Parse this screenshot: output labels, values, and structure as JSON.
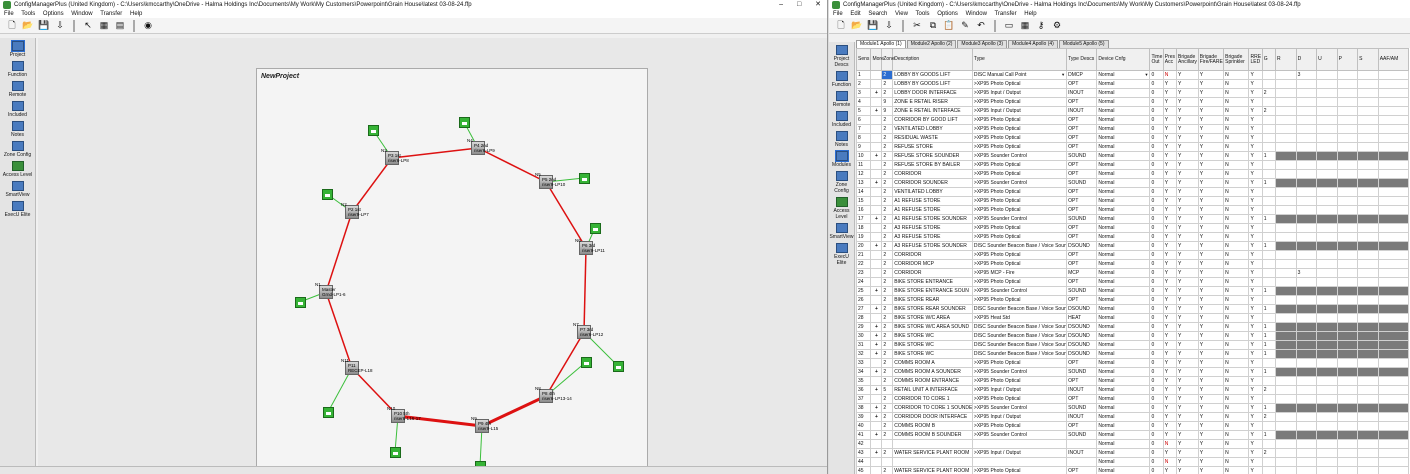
{
  "windows": [
    {
      "title": "ConfigManagerPlus (United Kingdom) - C:\\Users\\kmccarthy\\OneDrive - Halma Holdings Inc\\Documents\\My Work\\My Customers\\Powerpoint\\Grain House\\latest 03-08-24.ffp",
      "menu": [
        "File",
        "Tools",
        "Options",
        "Window",
        "Transfer",
        "Help"
      ]
    },
    {
      "title": "ConfigManagerPlus (United Kingdom) - C:\\Users\\kmccarthy\\OneDrive - Halma Holdings Inc\\Documents\\My Work\\My Customers\\Powerpoint\\Grain House\\latest 03-08-24.ffp",
      "menu": [
        "File",
        "Edit",
        "Search",
        "View",
        "Tools",
        "Options",
        "Window",
        "Transfer",
        "Help"
      ]
    }
  ],
  "window_controls": {
    "minimize": "–",
    "maximize": "□",
    "close": "✕"
  },
  "sidebar_left": [
    "Project",
    "Function",
    "Remote",
    "Included",
    "Notes",
    "Zone Config",
    "Access Level",
    "SmartView",
    "ExecU Elite"
  ],
  "sidebar_right": [
    "Project Descs",
    "Function",
    "Remote",
    "Included",
    "Notes",
    "Modules",
    "Zone Config",
    "Access Level",
    "SmartView",
    "ExecU Elite"
  ],
  "canvas": {
    "title": "NewProject"
  },
  "nodes": [
    {
      "num": "N3",
      "l1": "P3 1st",
      "l2": "riser6-LP8"
    },
    {
      "num": "N4",
      "l1": "P4 2nd",
      "l2": "riser6-LP9"
    },
    {
      "num": "N5",
      "l1": "P5 2nd",
      "l2": "riser9-LP10"
    },
    {
      "num": "N6",
      "l1": "P6 3rd",
      "l2": "riser9-LP11"
    },
    {
      "num": "N7",
      "l1": "P7 3rd",
      "l2": "riser6-LP12"
    },
    {
      "num": "N8",
      "l1": "P8 4th",
      "l2": "riser6-LP13-14"
    },
    {
      "num": "N9",
      "l1": "P9 4th",
      "l2": "riser9-L15"
    },
    {
      "num": "N10",
      "l1": "P10 5th",
      "l2": "riser6-L16-17"
    },
    {
      "num": "N11",
      "l1": "P11",
      "l2": "RECEP-L18"
    },
    {
      "num": "N1",
      "l1": "Master",
      "l2": "Grnd-LP1-6"
    },
    {
      "num": "N2",
      "l1": "P2 1st",
      "l2": "riser9-LP7"
    }
  ],
  "module_tabs": [
    "Module1 Apollo (1)",
    "Module2 Apollo (2)",
    "Module3 Apollo (3)",
    "Module4 Apollo (4)",
    "Module5 Apollo (5)"
  ],
  "columns": [
    "Sens",
    "More",
    "Zone",
    "Description",
    "Type",
    "Type Descs",
    "Device Cnfg",
    "Time Out",
    "Pres Acc",
    "Brigade Ancillary",
    "Brigade Fire/FARE",
    "Brigade Sprinkler",
    "RRE LED",
    "G",
    "R",
    "D",
    "U",
    "P",
    "S",
    "AAF/AM"
  ],
  "rows": [
    [
      "1",
      "",
      "2",
      "LOBBY BY GOODS LIFT",
      "DISC Manual Call Point",
      "DMCP",
      "Normal",
      "0",
      "N",
      "Y",
      "Y",
      "N",
      "Y",
      "",
      "3"
    ],
    [
      "2",
      "",
      "2",
      "LOBBY BY GOODS LIFT",
      ">XP95 Photo Optical",
      "OPT",
      "Normal",
      "0",
      "Y",
      "Y",
      "Y",
      "N",
      "Y",
      "",
      ""
    ],
    [
      "3",
      "+",
      "2",
      "LOBBY DOOR INTERFACE",
      ">XP95 Input / Output",
      "INOUT",
      "Normal",
      "0",
      "Y",
      "Y",
      "Y",
      "N",
      "Y",
      "2",
      ""
    ],
    [
      "4",
      "",
      "9",
      "ZONE E RETAIL RISER",
      ">XP95 Photo Optical",
      "OPT",
      "Normal",
      "0",
      "Y",
      "Y",
      "Y",
      "N",
      "Y",
      "",
      ""
    ],
    [
      "5",
      "+",
      "9",
      "ZONE E RETAIL INTERFACE",
      ">XP95 Input / Output",
      "INOUT",
      "Normal",
      "0",
      "Y",
      "Y",
      "Y",
      "N",
      "Y",
      "2",
      ""
    ],
    [
      "6",
      "",
      "2",
      "CORRIDOR BY GOOD LIFT",
      ">XP95 Photo Optical",
      "OPT",
      "Normal",
      "0",
      "Y",
      "Y",
      "Y",
      "N",
      "Y",
      "",
      ""
    ],
    [
      "7",
      "",
      "2",
      "VENTILATED LOBBY",
      ">XP95 Photo Optical",
      "OPT",
      "Normal",
      "0",
      "Y",
      "Y",
      "Y",
      "N",
      "Y",
      "",
      ""
    ],
    [
      "8",
      "",
      "2",
      "RESIDUAL WASTE",
      ">XP95 Photo Optical",
      "OPT",
      "Normal",
      "0",
      "Y",
      "Y",
      "Y",
      "N",
      "Y",
      "",
      ""
    ],
    [
      "9",
      "",
      "2",
      "REFUSE STORE",
      ">XP95 Photo Optical",
      "OPT",
      "Normal",
      "0",
      "Y",
      "Y",
      "Y",
      "N",
      "Y",
      "",
      ""
    ],
    [
      "10",
      "+",
      "2",
      "REFUSE STORE SOUNDER",
      ">XP95 Sounder Control",
      "SOUND",
      "Normal",
      "0",
      "Y",
      "Y",
      "Y",
      "N",
      "Y",
      "1",
      "D"
    ],
    [
      "11",
      "",
      "2",
      "REFUSE STORE BY BAILER",
      ">XP95 Photo Optical",
      "OPT",
      "Normal",
      "0",
      "Y",
      "Y",
      "Y",
      "N",
      "Y",
      "",
      ""
    ],
    [
      "12",
      "",
      "2",
      "CORRIDOR",
      ">XP95 Photo Optical",
      "OPT",
      "Normal",
      "0",
      "Y",
      "Y",
      "Y",
      "N",
      "Y",
      "",
      ""
    ],
    [
      "13",
      "+",
      "2",
      "CORRIDOR SOUNDER",
      ">XP95 Sounder Control",
      "SOUND",
      "Normal",
      "0",
      "Y",
      "Y",
      "Y",
      "N",
      "Y",
      "1",
      "D"
    ],
    [
      "14",
      "",
      "2",
      "VENTILATED LOBBY",
      ">XP95 Photo Optical",
      "OPT",
      "Normal",
      "0",
      "Y",
      "Y",
      "Y",
      "N",
      "Y",
      "",
      ""
    ],
    [
      "15",
      "",
      "2",
      "A1 REFUSE STORE",
      ">XP95 Photo Optical",
      "OPT",
      "Normal",
      "0",
      "Y",
      "Y",
      "Y",
      "N",
      "Y",
      "",
      ""
    ],
    [
      "16",
      "",
      "2",
      "A1 REFUSE STORE",
      ">XP95 Photo Optical",
      "OPT",
      "Normal",
      "0",
      "Y",
      "Y",
      "Y",
      "N",
      "Y",
      "",
      ""
    ],
    [
      "17",
      "+",
      "2",
      "A1 REFUSE STORE SOUNDER",
      ">XP95 Sounder Control",
      "SOUND",
      "Normal",
      "0",
      "Y",
      "Y",
      "Y",
      "N",
      "Y",
      "1",
      "D"
    ],
    [
      "18",
      "",
      "2",
      "A3 REFUSE STORE",
      ">XP95 Photo Optical",
      "OPT",
      "Normal",
      "0",
      "Y",
      "Y",
      "Y",
      "N",
      "Y",
      "",
      ""
    ],
    [
      "19",
      "",
      "2",
      "A3 REFUSE STORE",
      ">XP95 Photo Optical",
      "OPT",
      "Normal",
      "0",
      "Y",
      "Y",
      "Y",
      "N",
      "Y",
      "",
      ""
    ],
    [
      "20",
      "+",
      "2",
      "A3 REFUSE STORE SOUNDER",
      "DISC Sounder Beacon Base / Voice Sounder",
      "DSOUND",
      "Normal",
      "0",
      "Y",
      "Y",
      "Y",
      "N",
      "Y",
      "1",
      "D"
    ],
    [
      "21",
      "",
      "2",
      "CORRIDOR",
      ">XP95 Photo Optical",
      "OPT",
      "Normal",
      "0",
      "Y",
      "Y",
      "Y",
      "N",
      "Y",
      "",
      ""
    ],
    [
      "22",
      "",
      "2",
      "CORRIDOR MCP",
      ">XP95 Photo Optical",
      "OPT",
      "Normal",
      "0",
      "Y",
      "Y",
      "Y",
      "N",
      "Y",
      "",
      ""
    ],
    [
      "23",
      "",
      "2",
      "CORRIDOR",
      ">XP95 MCP - Fire",
      "MCP",
      "Normal",
      "0",
      "Y",
      "Y",
      "Y",
      "N",
      "Y",
      "",
      "3"
    ],
    [
      "24",
      "",
      "2",
      "BIKE STORE ENTRANCE",
      ">XP95 Photo Optical",
      "OPT",
      "Normal",
      "0",
      "Y",
      "Y",
      "Y",
      "N",
      "Y",
      "",
      ""
    ],
    [
      "25",
      "+",
      "2",
      "BIKE STORE ENTRANCE SOUN",
      ">XP95 Sounder Control",
      "SOUND",
      "Normal",
      "0",
      "Y",
      "Y",
      "Y",
      "N",
      "Y",
      "1",
      "D"
    ],
    [
      "26",
      "",
      "2",
      "BIKE STORE REAR",
      ">XP95 Photo Optical",
      "OPT",
      "Normal",
      "0",
      "Y",
      "Y",
      "Y",
      "N",
      "Y",
      "",
      ""
    ],
    [
      "27",
      "+",
      "2",
      "BIKE STORE REAR SOUNDER",
      "DISC Sounder Beacon Base / Voice Sounder",
      "DSOUND",
      "Normal",
      "0",
      "Y",
      "Y",
      "Y",
      "N",
      "Y",
      "1",
      "D"
    ],
    [
      "28",
      "",
      "2",
      "BIKE STORE W/C AREA",
      ">XP95 Heat Std",
      "HEAT",
      "Normal",
      "0",
      "Y",
      "Y",
      "Y",
      "N",
      "Y",
      "",
      ""
    ],
    [
      "29",
      "+",
      "2",
      "BIKE STORE W/C AREA SOUND",
      "DISC Sounder Beacon Base / Voice Sounder",
      "DSOUND",
      "Normal",
      "0",
      "Y",
      "Y",
      "Y",
      "N",
      "Y",
      "1",
      "D"
    ],
    [
      "30",
      "+",
      "2",
      "BIKE STORE WC",
      "DISC Sounder Beacon Base / Voice Sounder",
      "DSOUND",
      "Normal",
      "0",
      "Y",
      "Y",
      "Y",
      "N",
      "Y",
      "1",
      "D"
    ],
    [
      "31",
      "+",
      "2",
      "BIKE STORE WC",
      "DISC Sounder Beacon Base / Voice Sounder",
      "DSOUND",
      "Normal",
      "0",
      "Y",
      "Y",
      "Y",
      "N",
      "Y",
      "1",
      "D"
    ],
    [
      "32",
      "+",
      "2",
      "BIKE STORE WC",
      "DISC Sounder Beacon Base / Voice Sounder",
      "DSOUND",
      "Normal",
      "0",
      "Y",
      "Y",
      "Y",
      "N",
      "Y",
      "1",
      "D"
    ],
    [
      "33",
      "",
      "2",
      "COMMS ROOM A",
      ">XP95 Photo Optical",
      "OPT",
      "Normal",
      "0",
      "Y",
      "Y",
      "Y",
      "N",
      "Y",
      "",
      ""
    ],
    [
      "34",
      "+",
      "2",
      "COMMS ROOM A SOUNDER",
      ">XP95 Sounder Control",
      "SOUND",
      "Normal",
      "0",
      "Y",
      "Y",
      "Y",
      "N",
      "Y",
      "1",
      "D"
    ],
    [
      "35",
      "",
      "2",
      "COMMS ROOM ENTRANCE",
      ">XP95 Photo Optical",
      "OPT",
      "Normal",
      "0",
      "Y",
      "Y",
      "Y",
      "N",
      "Y",
      "",
      ""
    ],
    [
      "36",
      "+",
      "5",
      "RETAIL UNIT A INTERFACE",
      ">XP95 Input / Output",
      "INOUT",
      "Normal",
      "0",
      "Y",
      "Y",
      "Y",
      "N",
      "Y",
      "2",
      ""
    ],
    [
      "37",
      "",
      "2",
      "CORRIDOR TO CORE 1",
      ">XP95 Photo Optical",
      "OPT",
      "Normal",
      "0",
      "Y",
      "Y",
      "Y",
      "N",
      "Y",
      "",
      ""
    ],
    [
      "38",
      "+",
      "2",
      "CORRIDOR TO CORE 1 SOUNDE",
      ">XP95 Sounder Control",
      "SOUND",
      "Normal",
      "0",
      "Y",
      "Y",
      "Y",
      "N",
      "Y",
      "1",
      "D"
    ],
    [
      "39",
      "+",
      "2",
      "CORRIDOR DOOR INTERFACE",
      ">XP95 Input / Output",
      "INOUT",
      "Normal",
      "0",
      "Y",
      "Y",
      "Y",
      "N",
      "Y",
      "2",
      ""
    ],
    [
      "40",
      "",
      "2",
      "COMMS ROOM B",
      ">XP95 Photo Optical",
      "OPT",
      "Normal",
      "0",
      "Y",
      "Y",
      "Y",
      "N",
      "Y",
      "",
      ""
    ],
    [
      "41",
      "+",
      "2",
      "COMMS ROOM B SOUNDER",
      ">XP95 Sounder Control",
      "SOUND",
      "Normal",
      "0",
      "Y",
      "Y",
      "Y",
      "N",
      "Y",
      "1",
      "D"
    ],
    [
      "42",
      "",
      "",
      "",
      "",
      "",
      "Normal",
      "0",
      "N",
      "Y",
      "Y",
      "N",
      "Y",
      "",
      ""
    ],
    [
      "43",
      "+",
      "2",
      "WATER SERVICE PLANT ROOM",
      ">XP95 Input / Output",
      "INOUT",
      "Normal",
      "0",
      "Y",
      "Y",
      "Y",
      "N",
      "Y",
      "2",
      ""
    ],
    [
      "44",
      "",
      "",
      "",
      "",
      "",
      "Normal",
      "0",
      "N",
      "Y",
      "Y",
      "N",
      "Y",
      "",
      ""
    ],
    [
      "45",
      "",
      "2",
      "WATER SERVICE PLANT ROOM",
      ">XP95 Photo Optical",
      "OPT",
      "Normal",
      "0",
      "Y",
      "Y",
      "Y",
      "N",
      "Y",
      "",
      ""
    ],
    [
      "46",
      "+",
      "2",
      "WATER SERVICE PLANT ROOM",
      "DISC Sounder Beacon Base / Voice Sounder",
      "DSOUND",
      "Normal",
      "0",
      "Y",
      "Y",
      "Y",
      "N",
      "Y",
      "1",
      "D"
    ]
  ]
}
